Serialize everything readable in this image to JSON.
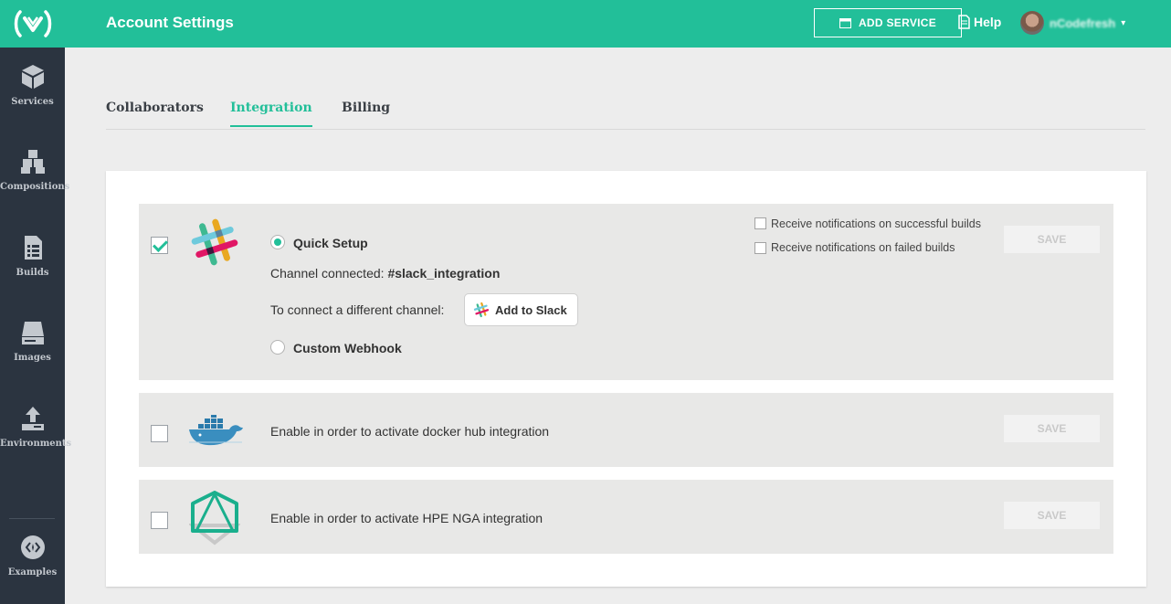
{
  "sidebar": {
    "items": [
      {
        "label": "Services",
        "icon": "cube-icon"
      },
      {
        "label": "Compositions",
        "icon": "cubes-icon"
      },
      {
        "label": "Builds",
        "icon": "document-list-icon"
      },
      {
        "label": "Images",
        "icon": "drive-icon"
      },
      {
        "label": "Environments",
        "icon": "upload-icon"
      },
      {
        "label": "Examples",
        "icon": "code-circle-icon"
      }
    ]
  },
  "header": {
    "title": "Account Settings",
    "add_service_label": "ADD SERVICE",
    "help_label": "Help",
    "username": "nCodefresh"
  },
  "tabs": [
    {
      "label": "Collaborators",
      "active": false
    },
    {
      "label": "Integration",
      "active": true
    },
    {
      "label": "Billing",
      "active": false
    }
  ],
  "integrations": {
    "slack": {
      "enabled": true,
      "quick_setup_label": "Quick Setup",
      "channel_prefix": "Channel connected: ",
      "channel_name": "#slack_integration",
      "connect_text": "To connect a different channel:",
      "add_to_slack_label": "Add to Slack",
      "custom_webhook_label": "Custom Webhook",
      "notify_success_label": "Receive notifications on successful builds",
      "notify_failed_label": "Receive notifications on failed builds",
      "save_label": "SAVE"
    },
    "docker": {
      "enabled": false,
      "description": "Enable in order to activate docker hub integration",
      "save_label": "SAVE"
    },
    "nga": {
      "enabled": false,
      "description": "Enable in order to activate HPE NGA integration",
      "save_label": "SAVE"
    }
  },
  "colors": {
    "brand": "#22bf99",
    "sidebar": "#2b3440"
  }
}
